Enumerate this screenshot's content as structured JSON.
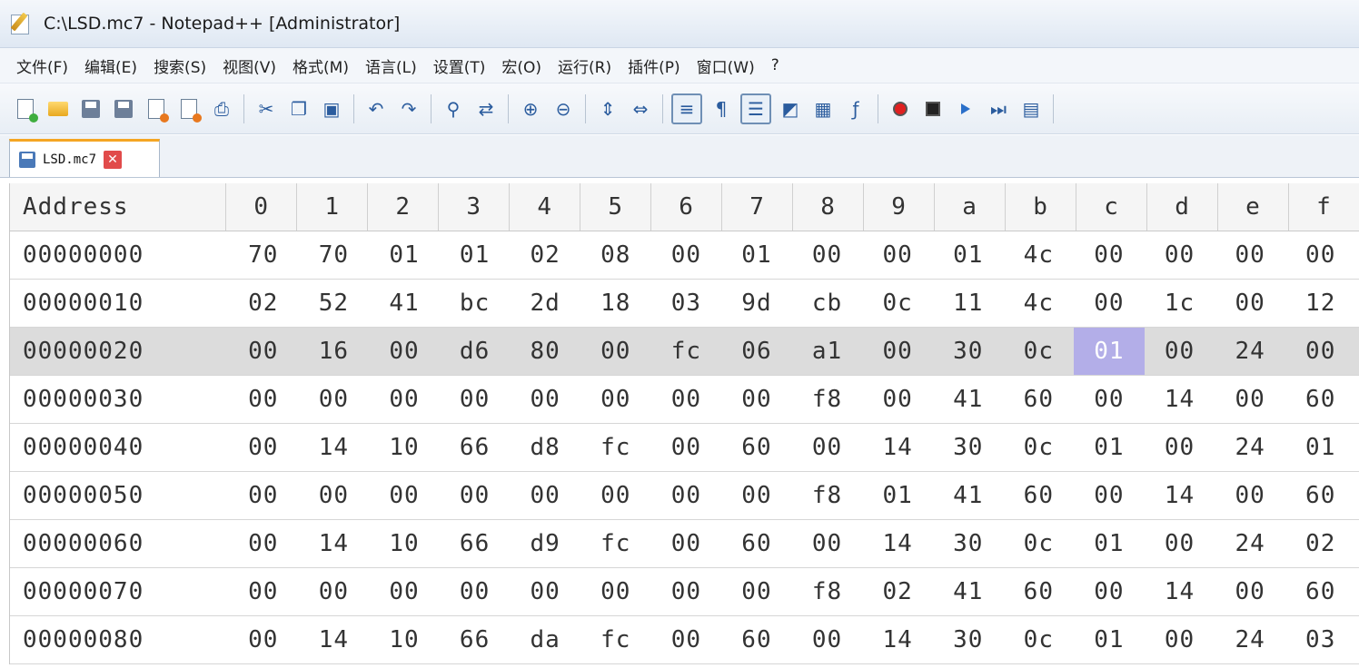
{
  "window": {
    "title": "C:\\LSD.mc7 - Notepad++ [Administrator]"
  },
  "menu": [
    "文件(F)",
    "编辑(E)",
    "搜索(S)",
    "视图(V)",
    "格式(M)",
    "语言(L)",
    "设置(T)",
    "宏(O)",
    "运行(R)",
    "插件(P)",
    "窗口(W)",
    "?"
  ],
  "toolbar": {
    "icons": [
      "new-file-icon",
      "open-folder-icon",
      "save-icon",
      "save-all-icon",
      "close-file-icon",
      "close-all-icon",
      "print-icon",
      "cut-icon",
      "copy-icon",
      "paste-icon",
      "undo-icon",
      "redo-icon",
      "find-icon",
      "replace-icon",
      "zoom-in-icon",
      "zoom-out-icon",
      "sync-vertical-icon",
      "sync-horizontal-icon",
      "word-wrap-icon",
      "show-all-chars-icon",
      "indent-guide-icon",
      "user-lang-icon",
      "doc-map-icon",
      "function-list-icon",
      "record-macro-icon",
      "stop-record-icon",
      "play-macro-icon",
      "run-macro-multiple-icon",
      "save-macro-icon"
    ]
  },
  "tab": {
    "label": "LSD.mc7",
    "close": "✕"
  },
  "hex": {
    "header": [
      "Address",
      "0",
      "1",
      "2",
      "3",
      "4",
      "5",
      "6",
      "7",
      "8",
      "9",
      "a",
      "b",
      "c",
      "d",
      "e",
      "f"
    ],
    "rows": [
      {
        "addr": "00000000",
        "bytes": [
          "70",
          "70",
          "01",
          "01",
          "02",
          "08",
          "00",
          "01",
          "00",
          "00",
          "01",
          "4c",
          "00",
          "00",
          "00",
          "00"
        ]
      },
      {
        "addr": "00000010",
        "bytes": [
          "02",
          "52",
          "41",
          "bc",
          "2d",
          "18",
          "03",
          "9d",
          "cb",
          "0c",
          "11",
          "4c",
          "00",
          "1c",
          "00",
          "12"
        ]
      },
      {
        "addr": "00000020",
        "bytes": [
          "00",
          "16",
          "00",
          "d6",
          "80",
          "00",
          "fc",
          "06",
          "a1",
          "00",
          "30",
          "0c",
          "01",
          "00",
          "24",
          "00"
        ]
      },
      {
        "addr": "00000030",
        "bytes": [
          "00",
          "00",
          "00",
          "00",
          "00",
          "00",
          "00",
          "00",
          "f8",
          "00",
          "41",
          "60",
          "00",
          "14",
          "00",
          "60"
        ]
      },
      {
        "addr": "00000040",
        "bytes": [
          "00",
          "14",
          "10",
          "66",
          "d8",
          "fc",
          "00",
          "60",
          "00",
          "14",
          "30",
          "0c",
          "01",
          "00",
          "24",
          "01"
        ]
      },
      {
        "addr": "00000050",
        "bytes": [
          "00",
          "00",
          "00",
          "00",
          "00",
          "00",
          "00",
          "00",
          "f8",
          "01",
          "41",
          "60",
          "00",
          "14",
          "00",
          "60"
        ]
      },
      {
        "addr": "00000060",
        "bytes": [
          "00",
          "14",
          "10",
          "66",
          "d9",
          "fc",
          "00",
          "60",
          "00",
          "14",
          "30",
          "0c",
          "01",
          "00",
          "24",
          "02"
        ]
      },
      {
        "addr": "00000070",
        "bytes": [
          "00",
          "00",
          "00",
          "00",
          "00",
          "00",
          "00",
          "00",
          "f8",
          "02",
          "41",
          "60",
          "00",
          "14",
          "00",
          "60"
        ]
      },
      {
        "addr": "00000080",
        "bytes": [
          "00",
          "14",
          "10",
          "66",
          "da",
          "fc",
          "00",
          "60",
          "00",
          "14",
          "30",
          "0c",
          "01",
          "00",
          "24",
          "03"
        ]
      }
    ],
    "current_row": 2,
    "selected_col": 12
  },
  "colors": {
    "selection": "#b3aee8",
    "current_line": "#dcdcdc",
    "tab_accent": "#f5a623"
  }
}
